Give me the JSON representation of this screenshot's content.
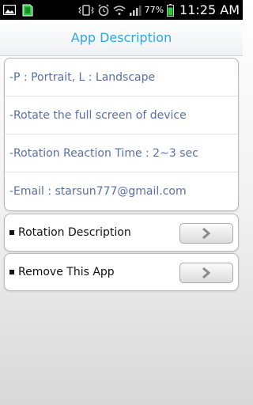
{
  "status_bar": {
    "icons": [
      "gallery-icon",
      "sd-card-icon",
      "vibrate-icon",
      "alarm-icon",
      "wifi-icon",
      "signal-icon",
      "battery-icon"
    ],
    "battery_percent": "77%",
    "time": "11:25 AM"
  },
  "header": {
    "title": "App Description"
  },
  "description": {
    "items": [
      "-P : Portrait, L : Landscape",
      "-Rotate the full screen of device",
      "-Rotation Reaction Time : 2~3 sec",
      "-Email : starsun777@gmail.com"
    ]
  },
  "actions": {
    "rotation_description_label": "Rotation Description",
    "remove_app_label": "Remove This App",
    "arrow_icon": "chevron-right-icon"
  },
  "colors": {
    "title": "#29a8e8",
    "description_text": "#5b6ea8",
    "status_bar_bg": "#000000",
    "battery_fill": "#2ecc40"
  }
}
